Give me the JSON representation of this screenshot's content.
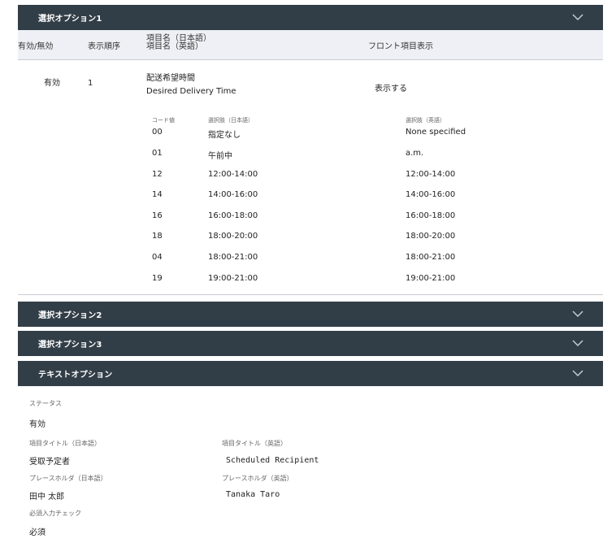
{
  "option1": {
    "title": "選択オプション1",
    "headers": {
      "enabled": "有効/無効",
      "order": "表示順序",
      "name_ja": "項目名（日本語）",
      "name_en": "項目名（英語）",
      "front": "フロント項目表示"
    },
    "row": {
      "enabled": "有効",
      "order": "1",
      "name_ja": "配送希望時間",
      "name_en": "Desired Delivery Time",
      "front": "表示する"
    },
    "choice_headers": {
      "code": "コード値",
      "ja": "選択肢（日本語）",
      "en": "選択肢（英語）"
    },
    "choices": [
      {
        "code": "00",
        "ja": "指定なし",
        "en": "None specified"
      },
      {
        "code": "01",
        "ja": "午前中",
        "en": "a.m."
      },
      {
        "code": "12",
        "ja": "12:00-14:00",
        "en": "12:00-14:00"
      },
      {
        "code": "14",
        "ja": "14:00-16:00",
        "en": "14:00-16:00"
      },
      {
        "code": "16",
        "ja": "16:00-18:00",
        "en": "16:00-18:00"
      },
      {
        "code": "18",
        "ja": "18:00-20:00",
        "en": "18:00-20:00"
      },
      {
        "code": "04",
        "ja": "18:00-21:00",
        "en": "18:00-21:00"
      },
      {
        "code": "19",
        "ja": "19:00-21:00",
        "en": "19:00-21:00"
      }
    ]
  },
  "option2": {
    "title": "選択オプション2"
  },
  "option3": {
    "title": "選択オプション3"
  },
  "text_option": {
    "title": "テキストオプション",
    "status_label": "ステータス",
    "status_value": "有効",
    "title_ja_label": "項目タイトル（日本語）",
    "title_ja_value": "受取予定者",
    "title_en_label": "項目タイトル（英語）",
    "title_en_value": "Scheduled Recipient",
    "placeholder_ja_label": "プレースホルダ（日本語）",
    "placeholder_ja_value": "田中 太郎",
    "placeholder_en_label": "プレースホルダ（英語）",
    "placeholder_en_value": "Tanaka Taro",
    "required_label": "必須入力チェック",
    "required_value": "必須"
  },
  "icons": {
    "collapse": "chevron-down-icon"
  },
  "colors": {
    "header_bg": "#323e47",
    "column_header_bg": "#eef0f5"
  }
}
